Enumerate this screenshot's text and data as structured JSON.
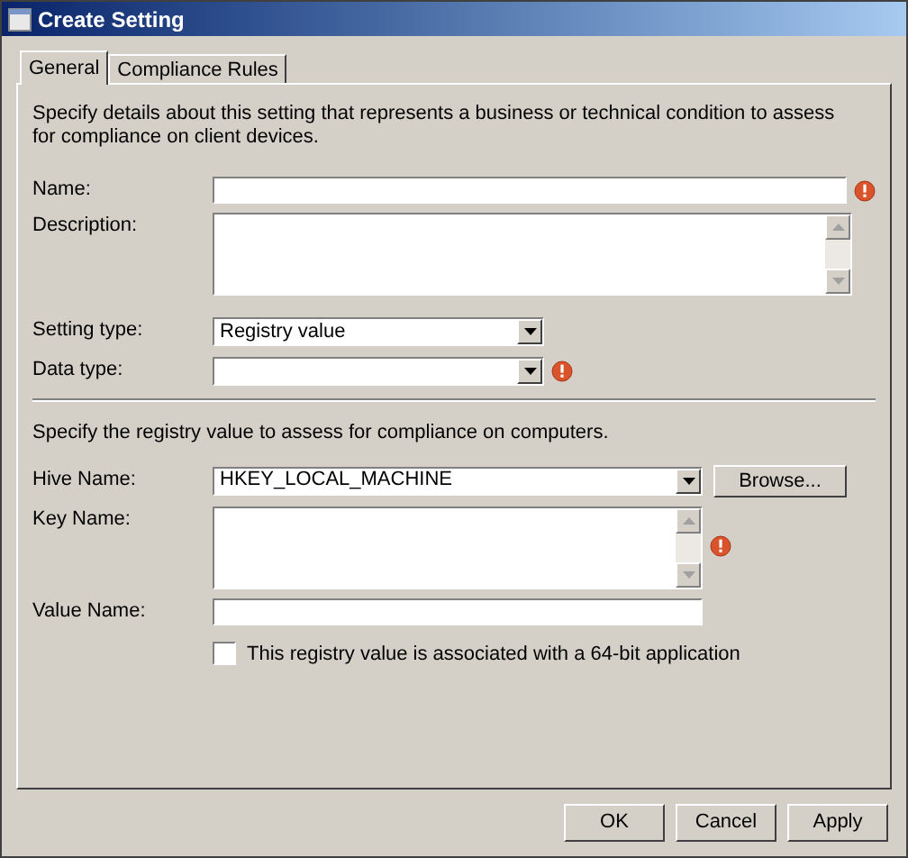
{
  "window": {
    "title": "Create Setting"
  },
  "tabs": [
    {
      "label": "General",
      "selected": true
    },
    {
      "label": "Compliance Rules",
      "selected": false
    }
  ],
  "intro": "Specify details about this setting that represents a business or technical condition to assess for compliance on client devices.",
  "fields": [
    {
      "label": "Name:",
      "kind": "text",
      "warning": true
    },
    {
      "label": "Description:",
      "kind": "textarea",
      "warning": false
    },
    {
      "label": "Setting type:",
      "kind": "combo",
      "value": "Registry value",
      "warning": false
    },
    {
      "label": "Data type:",
      "kind": "combo",
      "warning": true
    }
  ],
  "registry_intro": "Specify the registry value to assess for compliance on computers.",
  "registry_fields": [
    {
      "label": "Hive Name:",
      "kind": "combo",
      "value": "HKEY_LOCAL_MACHINE",
      "button": "Browse...",
      "warning": false
    },
    {
      "label": "Key Name:",
      "kind": "textarea",
      "warning": true
    },
    {
      "label": "Value Name:",
      "kind": "text",
      "warning": false
    }
  ],
  "checkbox": {
    "label": "This registry value is associated with a 64-bit application",
    "checked": false
  },
  "buttons": [
    "OK",
    "Cancel",
    "Apply"
  ]
}
